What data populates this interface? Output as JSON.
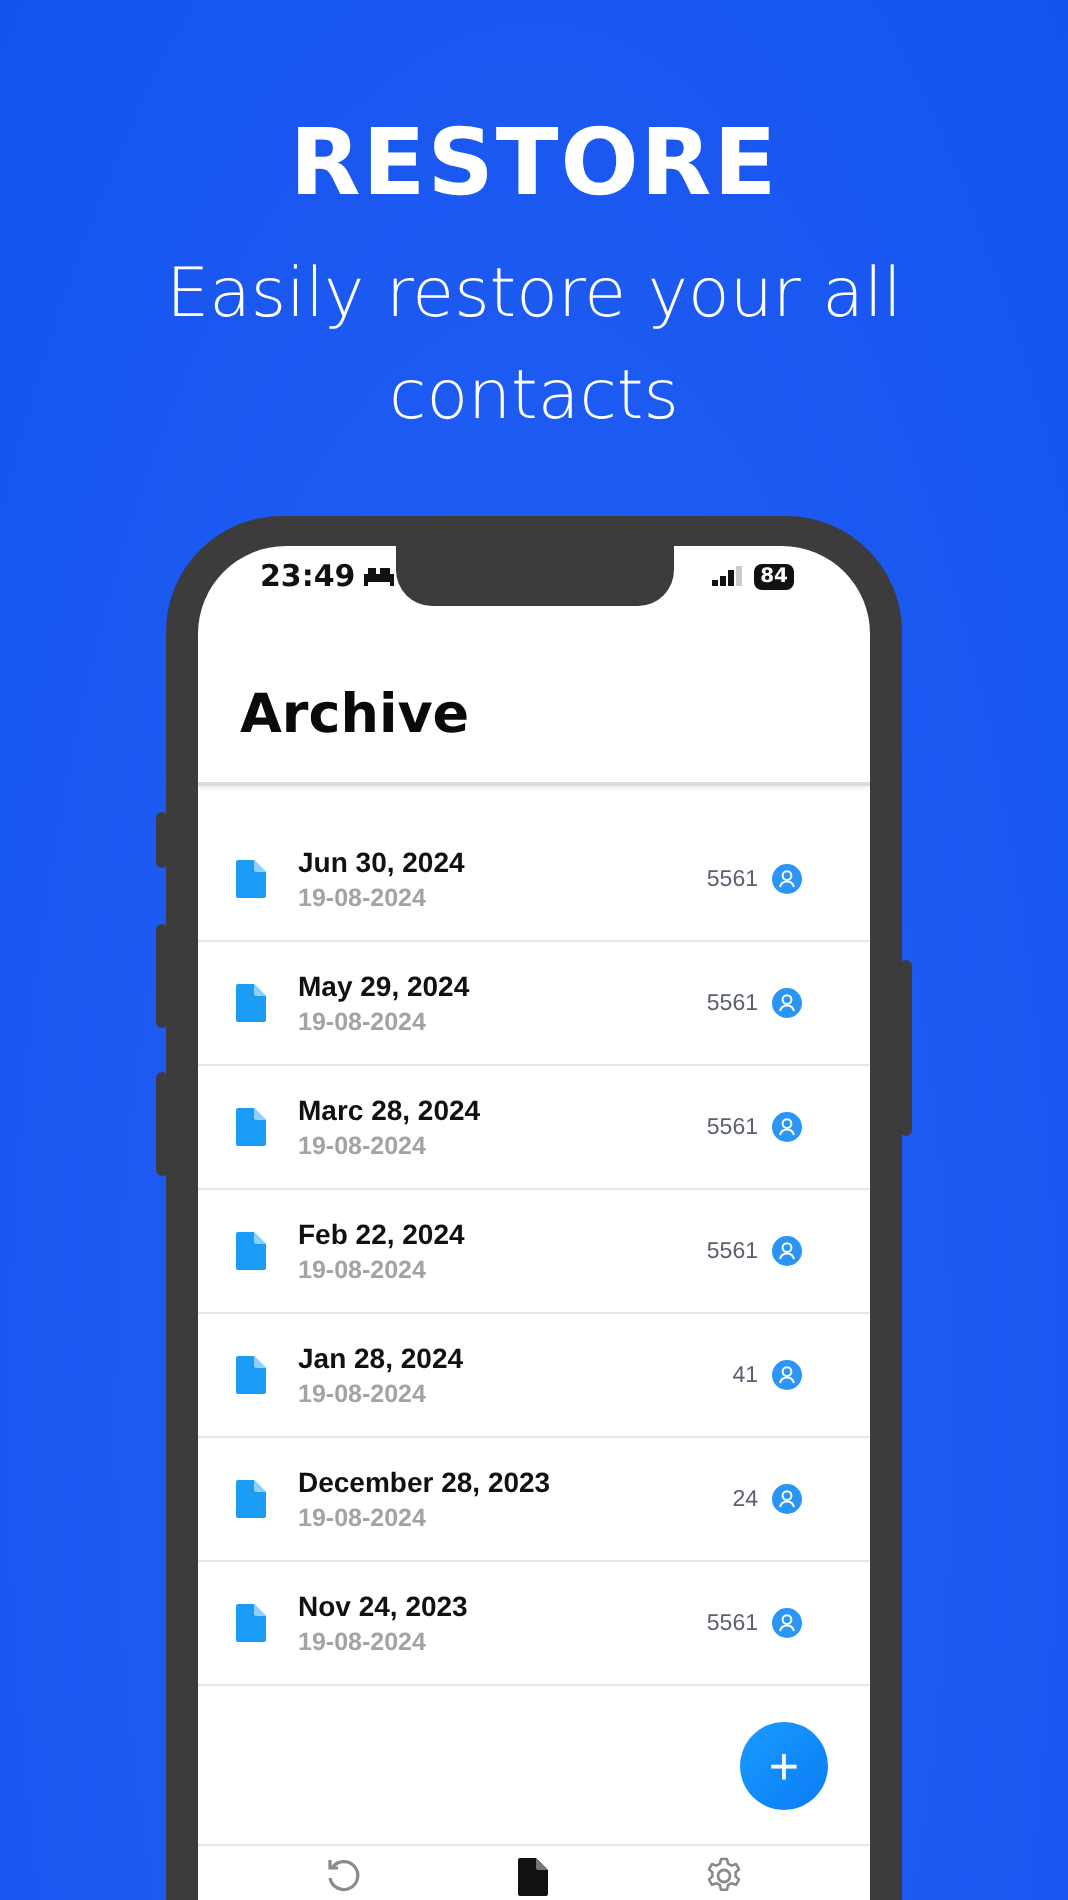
{
  "promo": {
    "title": "RESTORE",
    "subtitle": "Easily restore your all contacts"
  },
  "status_bar": {
    "time": "23:49",
    "battery": "84"
  },
  "screen_title": "Archive",
  "archives": [
    {
      "name": "Jun 30, 2024",
      "date": "19-08-2024",
      "count": "5561"
    },
    {
      "name": "May 29, 2024",
      "date": "19-08-2024",
      "count": "5561"
    },
    {
      "name": "Marc 28, 2024",
      "date": "19-08-2024",
      "count": "5561"
    },
    {
      "name": "Feb 22, 2024",
      "date": "19-08-2024",
      "count": "5561"
    },
    {
      "name": "Jan 28, 2024",
      "date": "19-08-2024",
      "count": "41"
    },
    {
      "name": "December 28, 2023",
      "date": "19-08-2024",
      "count": "24"
    },
    {
      "name": "Nov 24, 2023",
      "date": "19-08-2024",
      "count": "5561"
    }
  ],
  "fab": "+",
  "tabs": [
    {
      "kind": "restore",
      "selected": false
    },
    {
      "kind": "archive",
      "selected": true
    },
    {
      "kind": "settings",
      "selected": false
    }
  ]
}
